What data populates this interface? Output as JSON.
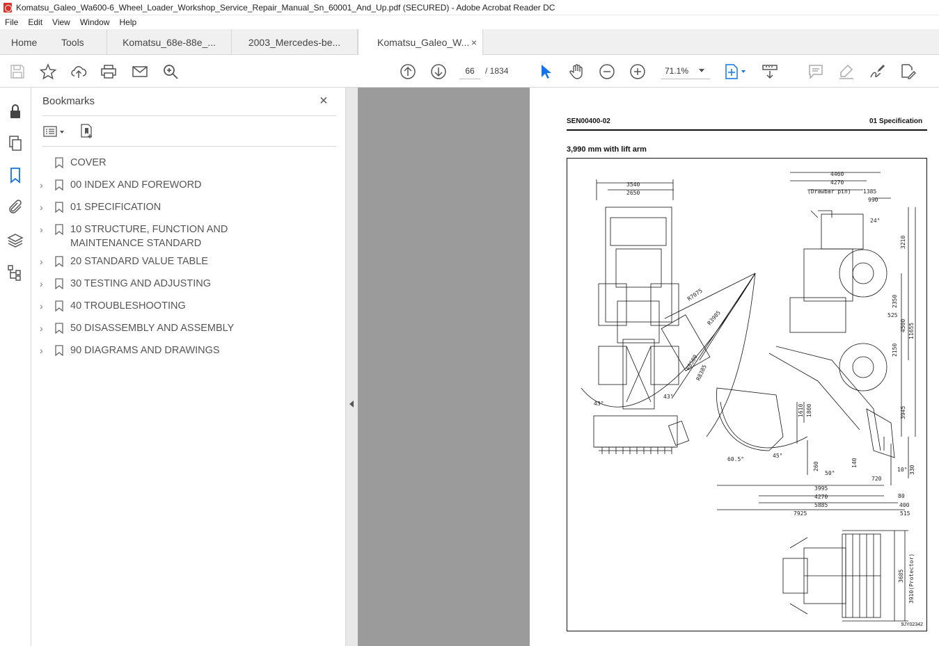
{
  "window": {
    "title": "Komatsu_Galeo_Wa600-6_Wheel_Loader_Workshop_Service_Repair_Manual_Sn_60001_And_Up.pdf (SECURED) - Adobe Acrobat Reader DC"
  },
  "menu": [
    "File",
    "Edit",
    "View",
    "Window",
    "Help"
  ],
  "tabs": {
    "home": "Home",
    "tools": "Tools",
    "docs": [
      "Komatsu_68e-88e_...",
      "2003_Mercedes-be...",
      "Komatsu_Galeo_W..."
    ],
    "active_close": "×"
  },
  "toolbar": {
    "current_page": "66",
    "page_total": "/  1834",
    "zoom": "71.1%"
  },
  "bookmarks": {
    "title": "Bookmarks",
    "close": "×",
    "items": [
      {
        "label": "COVER",
        "expandable": false
      },
      {
        "label": "00 INDEX AND FOREWORD",
        "expandable": true
      },
      {
        "label": "01 SPECIFICATION",
        "expandable": true
      },
      {
        "label": "10 STRUCTURE, FUNCTION AND MAINTENANCE STANDARD",
        "expandable": true
      },
      {
        "label": "20 STANDARD VALUE TABLE",
        "expandable": true
      },
      {
        "label": "30 TESTING AND ADJUSTING",
        "expandable": true
      },
      {
        "label": "40 TROUBLESHOOTING",
        "expandable": true
      },
      {
        "label": "50 DISASSEMBLY AND ASSEMBLY",
        "expandable": true
      },
      {
        "label": "90 DIAGRAMS AND DRAWINGS",
        "expandable": true
      }
    ]
  },
  "page": {
    "doc_code": "SEN00400-02",
    "section": "01 Specification",
    "caption": "3,990 mm with lift arm",
    "figure_code": "9JY02342",
    "dimensions": {
      "d4460": "4460",
      "d4270a": "4270",
      "d1385": "1385",
      "d990": "990",
      "d24": "24°",
      "d3210": "3210",
      "d2350": "2350",
      "d4500": "4500",
      "d11655": "11655",
      "d2150": "2150",
      "d525": "525",
      "d3945": "3945",
      "d1610": "1610",
      "d1800": "1800",
      "d45": "45°",
      "d605": "60.5°",
      "d260": "260",
      "d50": "50°",
      "d140": "140",
      "d720": "720",
      "d330": "330",
      "d10": "10°",
      "d3995": "3995",
      "d4270b": "4270",
      "d80": "80",
      "d5885": "5885",
      "d400": "400",
      "d7925": "7925",
      "d515": "515",
      "d3540": "3540",
      "d2650": "2650",
      "dR7075": "R7075",
      "dR3905": "R3905",
      "dR8580": "R8580",
      "dR8385": "R8385",
      "d43a": "43°",
      "d43b": "43°",
      "d3685": "3685",
      "d3910": "3910(Protector)",
      "drawbar": "(Drawbar pin)"
    }
  }
}
